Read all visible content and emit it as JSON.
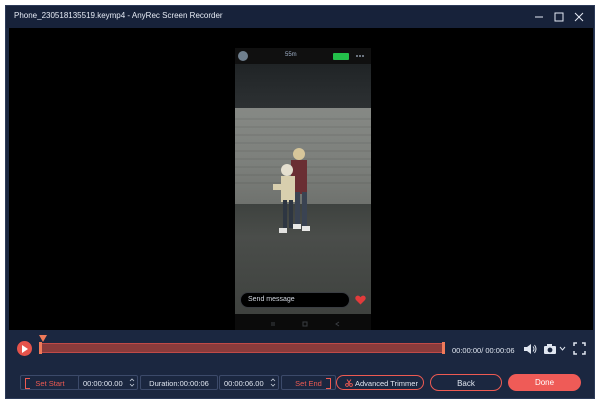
{
  "window": {
    "title": "Phone_230518135519.keymp4  -  AnyRec Screen Recorder",
    "controls": [
      "minimize-icon",
      "maximize-icon",
      "close-icon"
    ]
  },
  "video": {
    "status_time": "55m",
    "message_placeholder": "Send message"
  },
  "playback": {
    "time_readout": "00:00:00/ 00:00:06",
    "progress": 0.0
  },
  "trim": {
    "set_start_label": "Set Start",
    "start_value": "00:00:00.00",
    "duration_label": "Duration:00:00:06",
    "end_value": "00:00:06.00",
    "set_end_label": "Set End",
    "advanced_trimmer_label": "Advanced Trimmer"
  },
  "actions": {
    "back_label": "Back",
    "done_label": "Done"
  },
  "colors": {
    "accent": "#ef5b57",
    "window_bg": "#1b2740",
    "viewer_bg": "#000000"
  }
}
